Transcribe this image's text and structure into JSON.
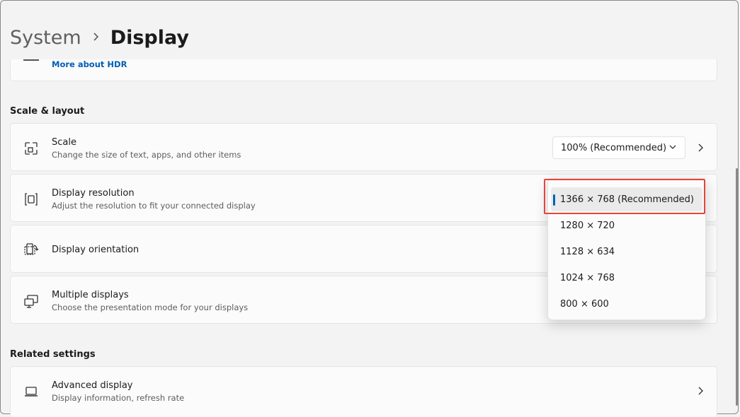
{
  "breadcrumb": {
    "parent": "System",
    "current": "Display"
  },
  "hdr_card": {
    "link": "More about HDR"
  },
  "scale_layout": {
    "section_title": "Scale & layout",
    "scale": {
      "title": "Scale",
      "subtitle": "Change the size of text, apps, and other items",
      "value": "100% (Recommended)"
    },
    "resolution": {
      "title": "Display resolution",
      "subtitle": "Adjust the resolution to fit your connected display"
    },
    "orientation": {
      "title": "Display orientation"
    },
    "multiple": {
      "title": "Multiple displays",
      "subtitle": "Choose the presentation mode for your displays"
    }
  },
  "resolution_dropdown": {
    "options": [
      "1366 × 768 (Recommended)",
      "1280 × 720",
      "1128 × 634",
      "1024 × 768",
      "800 × 600"
    ],
    "selected_index": 0
  },
  "related": {
    "section_title": "Related settings",
    "advanced": {
      "title": "Advanced display",
      "subtitle": "Display information, refresh rate"
    }
  },
  "colors": {
    "accent": "#005fb8",
    "highlight": "#e5453c"
  }
}
